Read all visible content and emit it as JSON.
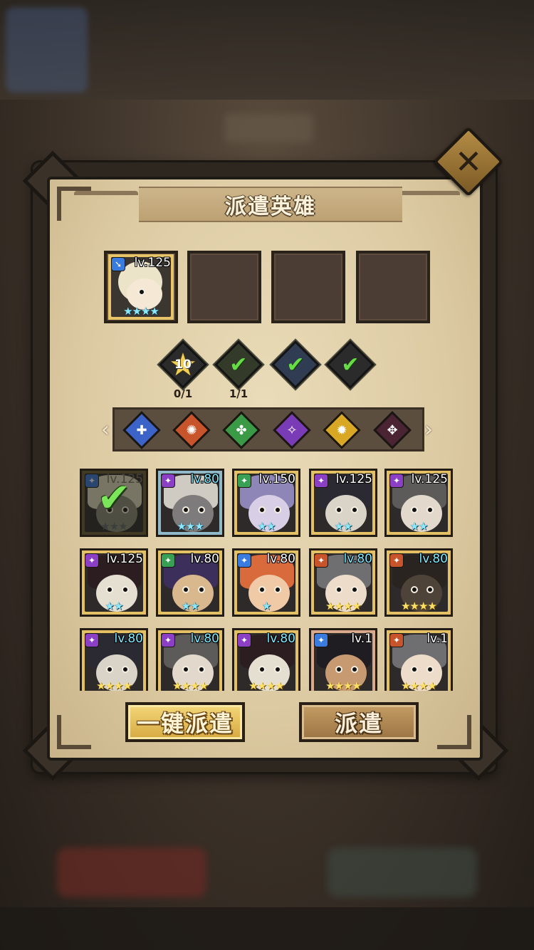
{
  "dialog": {
    "title": "派遣英雄",
    "close_glyph": "✕"
  },
  "selected_slots": [
    {
      "filled": true,
      "level": "lv.125",
      "stars": "★★★★",
      "badge_color": "#3a7be0"
    },
    {
      "filled": false
    },
    {
      "filled": false
    },
    {
      "filled": false
    }
  ],
  "requirements": [
    {
      "icon": "star-level-icon",
      "value": "10",
      "count": "0/1",
      "done": false
    },
    {
      "icon": "check-icon",
      "value": "✔",
      "count": "1/1",
      "done": true
    },
    {
      "icon": "check-icon",
      "value": "✔",
      "count": "",
      "done": true
    },
    {
      "icon": "check-icon",
      "value": "✔",
      "count": "",
      "done": true
    }
  ],
  "filter": {
    "left_arrow": "‹",
    "right_arrow": "›",
    "factions": [
      {
        "name": "faction-blue-icon",
        "color": "#3b63c8",
        "glyph": "✚"
      },
      {
        "name": "faction-orange-icon",
        "color": "#c7542a",
        "glyph": "✺"
      },
      {
        "name": "faction-green-icon",
        "color": "#3a9a45",
        "glyph": "✤"
      },
      {
        "name": "faction-purple-icon",
        "color": "#7a3bb6",
        "glyph": "✧"
      },
      {
        "name": "faction-gold-icon",
        "color": "#d8a825",
        "glyph": "✹"
      },
      {
        "name": "faction-dark-icon",
        "color": "#4b2434",
        "glyph": "✥"
      }
    ]
  },
  "heroes": [
    {
      "level": "lv.125",
      "stars": "★★★",
      "frame": "#6b5f3a",
      "badge": "#3a7be0",
      "selected": true,
      "lv_style": "grey",
      "star_style": "dim",
      "skin": "#8a8d7a",
      "hair": "#e8e2c8"
    },
    {
      "level": "lv.80",
      "stars": "★★★",
      "frame": "#8fb8c8",
      "badge": "#8a3fc4",
      "selected": false,
      "lv_style": "blue",
      "star_style": "cyan",
      "skin": "#7d7b7b",
      "hair": "#cfcac2"
    },
    {
      "level": "lv.150",
      "stars": "★★",
      "frame": "#e2c063",
      "badge": "#37a054",
      "selected": false,
      "lv_style": "white",
      "star_style": "cyan",
      "skin": "#d8cfe6",
      "hair": "#8f86b8"
    },
    {
      "level": "lv.125",
      "stars": "★★",
      "frame": "#e2c063",
      "badge": "#8a3fc4",
      "selected": false,
      "lv_style": "white",
      "star_style": "cyan",
      "skin": "#d9d3c8",
      "hair": "#2b2a33"
    },
    {
      "level": "lv.125",
      "stars": "★★",
      "frame": "#e2c063",
      "badge": "#8a3fc4",
      "selected": false,
      "lv_style": "white",
      "star_style": "cyan",
      "skin": "#e2d9cc",
      "hair": "#5d5b5a"
    },
    {
      "level": "lv.125",
      "stars": "★★",
      "frame": "#e2c063",
      "badge": "#8a3fc4",
      "selected": false,
      "lv_style": "white",
      "star_style": "cyan",
      "skin": "#e5dfd2",
      "hair": "#2b1d20"
    },
    {
      "level": "lv.80",
      "stars": "★★",
      "frame": "#e2c063",
      "badge": "#37a054",
      "selected": false,
      "lv_style": "white",
      "star_style": "cyan",
      "skin": "#d8b88c",
      "hair": "#3d2f5c"
    },
    {
      "level": "lv.80",
      "stars": "★",
      "frame": "#e2c063",
      "badge": "#3a7be0",
      "selected": false,
      "lv_style": "white",
      "star_style": "cyan",
      "skin": "#f0c9a6",
      "hair": "#d96a3c"
    },
    {
      "level": "lv.80",
      "stars": "★★★★",
      "frame": "#e2c063",
      "badge": "#c7542a",
      "selected": false,
      "lv_style": "blue",
      "star_style": "gold",
      "skin": "#ecdcc9",
      "hair": "#6f6f72"
    },
    {
      "level": "lv.80",
      "stars": "★★★★",
      "frame": "#e2c063",
      "badge": "#c7542a",
      "selected": false,
      "lv_style": "blue",
      "star_style": "gold",
      "skin": "#4d4338",
      "hair": "#2a2420"
    },
    {
      "level": "lv.80",
      "stars": "★★★★",
      "frame": "#e2c063",
      "badge": "#8a3fc4",
      "selected": false,
      "lv_style": "blue",
      "star_style": "gold",
      "skin": "#d9d3c8",
      "hair": "#2b2a33"
    },
    {
      "level": "lv.80",
      "stars": "★★★★",
      "frame": "#e2c063",
      "badge": "#8a3fc4",
      "selected": false,
      "lv_style": "blue",
      "star_style": "gold",
      "skin": "#e2d9cc",
      "hair": "#5d5b5a"
    },
    {
      "level": "lv.80",
      "stars": "★★★★",
      "frame": "#e2c063",
      "badge": "#8a3fc4",
      "selected": false,
      "lv_style": "blue",
      "star_style": "gold",
      "skin": "#e5dfd2",
      "hair": "#2b1d20"
    },
    {
      "level": "lv.1",
      "stars": "★★★★",
      "frame": "#d8a98a",
      "badge": "#3a7be0",
      "selected": false,
      "lv_style": "white",
      "star_style": "gold",
      "skin": "#c79a72",
      "hair": "#1f1c22"
    },
    {
      "level": "lv.1",
      "stars": "★★★★",
      "frame": "#e2c063",
      "badge": "#c7542a",
      "selected": false,
      "lv_style": "white",
      "star_style": "gold",
      "skin": "#ecdcc9",
      "hair": "#6f6f72"
    }
  ],
  "buttons": {
    "quick_dispatch": "一键派遣",
    "dispatch": "派遣"
  }
}
